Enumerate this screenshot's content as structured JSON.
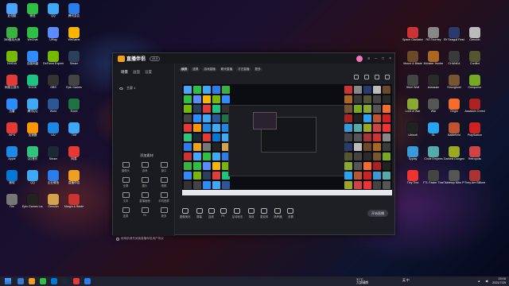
{
  "desktop": {
    "left_icons": [
      {
        "label": "此电脑",
        "color": "#4aa3ff"
      },
      {
        "label": "微信",
        "color": "#2fbf45"
      },
      {
        "label": "QQ",
        "color": "#3fa9f5"
      },
      {
        "label": "腾讯会议",
        "color": "#2b7de9"
      },
      {
        "label": "360驱动大师",
        "color": "#3cb043"
      },
      {
        "label": "WeChat",
        "color": "#2fbf45"
      },
      {
        "label": "UPlay",
        "color": "#5a8cff"
      },
      {
        "label": "WeGame",
        "color": "#f7b500"
      },
      {
        "label": "NVIDIA",
        "color": "#76b900"
      },
      {
        "label": "百度网盘",
        "color": "#2f8bff"
      },
      {
        "label": "GeForce Experience",
        "color": "#76b900"
      },
      {
        "label": "Steam",
        "color": "#2a3f5a"
      },
      {
        "label": "网易云音乐",
        "color": "#e23b3b"
      },
      {
        "label": "KOOK",
        "color": "#1fc27f"
      },
      {
        "label": "OBS",
        "color": "#333"
      },
      {
        "label": "Epic Games",
        "color": "#444"
      },
      {
        "label": "迅雷",
        "color": "#2b8cff"
      },
      {
        "label": "腾讯QQ",
        "color": "#3fa9f5"
      },
      {
        "label": "Word",
        "color": "#2b5797"
      },
      {
        "label": "Excel",
        "color": "#1f7244"
      },
      {
        "label": "WPS",
        "color": "#e53935"
      },
      {
        "label": "加速器",
        "color": "#ff9800"
      },
      {
        "label": "UU",
        "color": "#1e88e5"
      },
      {
        "label": "TIM",
        "color": "#3fa9f5"
      },
      {
        "label": "Apple",
        "color": "#1e88e5"
      },
      {
        "label": "QQ音乐",
        "color": "#31c27c"
      },
      {
        "label": "Steam",
        "color": "#1b2838"
      },
      {
        "label": "网易",
        "color": "#e53935"
      },
      {
        "label": "微软",
        "color": "#0078d4"
      },
      {
        "label": "QQ",
        "color": "#3fa9f5"
      },
      {
        "label": "企业微信",
        "color": "#2b7de9"
      },
      {
        "label": "直播伴侣",
        "color": "#f0a020"
      },
      {
        "label": "File",
        "color": "#777"
      },
      {
        "label": "Epic Games Launcher",
        "color": "#222"
      },
      {
        "label": "Genshin",
        "color": "#d4a24a"
      },
      {
        "label": "Margin & Blade",
        "color": "#c33"
      }
    ],
    "right_icons": [
      {
        "label": "Space Gladiators",
        "color": "#c33"
      },
      {
        "label": "RO Tourney",
        "color": "#888"
      },
      {
        "label": "Elf Seagull Restored",
        "color": "#2a3a6a"
      },
      {
        "label": "Genshin",
        "color": "#bbb"
      },
      {
        "label": "Mount & Blade",
        "color": "#6b4a2a"
      },
      {
        "label": "Monster Hunter",
        "color": "#aa6622"
      },
      {
        "label": "CHANKA",
        "color": "#3a3a3a"
      },
      {
        "label": "Conflict",
        "color": "#553"
      },
      {
        "label": "Steel Wolf",
        "color": "#444"
      },
      {
        "label": "Assassin",
        "color": "#2a2a2a"
      },
      {
        "label": "Stronghold",
        "color": "#775533"
      },
      {
        "label": "Conqueror",
        "color": "#7a2"
      },
      {
        "label": "Lord of War",
        "color": "#8a3"
      },
      {
        "label": "War",
        "color": "#555"
      },
      {
        "label": "Origin",
        "color": "#f56c2d"
      },
      {
        "label": "Assassin Creed",
        "color": "#a22"
      },
      {
        "label": "Ubisoft",
        "color": "#222"
      },
      {
        "label": "GL",
        "color": "#2aa3f0"
      },
      {
        "label": "Battlefield",
        "color": "#b53"
      },
      {
        "label": "PlayStation",
        "color": "#c22"
      },
      {
        "label": "Syplay",
        "color": "#3a9ad9"
      },
      {
        "label": "Circle Empires",
        "color": "#5aa"
      },
      {
        "label": "Darkest Dungeon",
        "color": "#9a2"
      },
      {
        "label": "Retropolis",
        "color": "#c44"
      },
      {
        "label": "Tiny Tina",
        "color": "#e33"
      },
      {
        "label": "FTL Faster Than Light",
        "color": "#444"
      },
      {
        "label": "Tabletop Nitro Peril",
        "color": "#555"
      },
      {
        "label": "They Are Billions",
        "color": "#a33"
      }
    ]
  },
  "app": {
    "name": "直播伴侣",
    "version": "v6.8",
    "scene_chips": [
      "横屏",
      "竖屏",
      "游戏直播",
      "聊天直播",
      "才艺直播",
      "更多"
    ],
    "tabs": [
      "场景",
      "画面",
      "设置"
    ],
    "scene_name": "主屏 1",
    "add_source_label": "添加素材",
    "tools": [
      {
        "label": "摄像头"
      },
      {
        "label": "游戏"
      },
      {
        "label": "窗口"
      },
      {
        "label": "全屏"
      },
      {
        "label": "图片"
      },
      {
        "label": "视频"
      },
      {
        "label": "文本"
      },
      {
        "label": "直播画面"
      },
      {
        "label": "手机投屏"
      },
      {
        "label": "连麦"
      },
      {
        "label": "PK"
      },
      {
        "label": "更多"
      }
    ],
    "notice": "使用前请先阅读直播伴侣用户协议",
    "controls": [
      {
        "label": "图像美化"
      },
      {
        "label": "屏幕"
      },
      {
        "label": "连线"
      },
      {
        "label": "PK"
      },
      {
        "label": "互动玩法"
      },
      {
        "label": "特效"
      },
      {
        "label": "麦克风"
      },
      {
        "label": "扬声器"
      },
      {
        "label": "设置"
      }
    ],
    "go_live": "开始直播"
  },
  "taskbar": {
    "apps_colors": [
      "#3a7bd5",
      "#f0a020",
      "#2fbf45",
      "#0078d4",
      "#1b2838",
      "#e53935",
      "#2b7de9"
    ],
    "weather_temp": "31°C",
    "weather_desc": "大部晴朗",
    "time": "15:16",
    "date": "2021/7/25",
    "tray_text": "英 中"
  }
}
